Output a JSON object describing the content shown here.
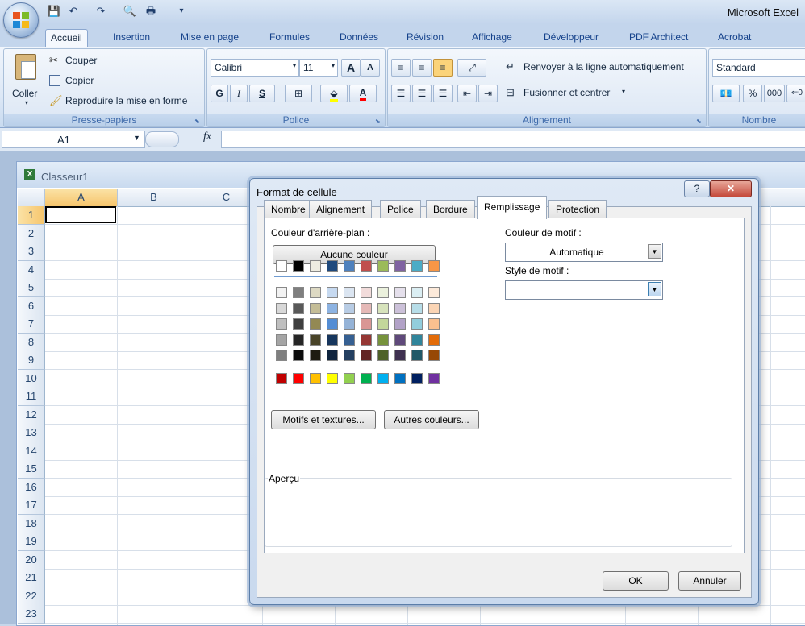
{
  "app": {
    "title": "Microsoft Excel",
    "window_title": "Classeur1"
  },
  "ribbon": {
    "tabs": [
      "Accueil",
      "Insertion",
      "Mise en page",
      "Formules",
      "Données",
      "Révision",
      "Affichage",
      "Développeur",
      "PDF Architect",
      "Acrobat"
    ],
    "active_tab": "Accueil",
    "clipboard": {
      "paste": "Coller",
      "cut": "Couper",
      "copy": "Copier",
      "format_painter": "Reproduire la mise en forme",
      "label": "Presse-papiers"
    },
    "font": {
      "name": "Calibri",
      "size": "11",
      "bold": "G",
      "italic": "I",
      "underline": "S",
      "label": "Police"
    },
    "alignment": {
      "wrap": "Renvoyer à la ligne automatiquement",
      "merge": "Fusionner et centrer",
      "label": "Alignement"
    },
    "number": {
      "format": "Standard",
      "percent": "%",
      "thousands": "000",
      "label": "Nombre"
    }
  },
  "formula_bar": {
    "name_box": "A1",
    "fx": "fx",
    "value": ""
  },
  "sheet": {
    "columns": [
      "A",
      "B",
      "C"
    ],
    "rows": [
      "1",
      "2",
      "3",
      "4",
      "5",
      "6",
      "7",
      "8",
      "9",
      "10",
      "11",
      "12",
      "13",
      "14",
      "15",
      "16",
      "17",
      "18",
      "19",
      "20",
      "21",
      "22",
      "23"
    ],
    "selected_cell": "A1"
  },
  "dialog": {
    "title": "Format de cellule",
    "help": "?",
    "close": "✕",
    "tabs": [
      "Nombre",
      "Alignement",
      "Police",
      "Bordure",
      "Remplissage",
      "Protection"
    ],
    "active_tab": "Remplissage",
    "bg_color_label": "Couleur d'arrière-plan :",
    "no_color_button": "Aucune couleur",
    "pattern_color_label": "Couleur de motif :",
    "pattern_color_value": "Automatique",
    "pattern_style_label": "Style de motif :",
    "pattern_style_value": "",
    "effects_button": "Motifs et textures...",
    "more_colors_button": "Autres couleurs...",
    "preview_label": "Aperçu",
    "ok": "OK",
    "cancel": "Annuler",
    "theme_colors": [
      "#ffffff",
      "#000000",
      "#eeece1",
      "#1f497d",
      "#4f81bd",
      "#c0504d",
      "#9bbb59",
      "#8064a2",
      "#4bacc6",
      "#f79646"
    ],
    "tint_rows": [
      [
        "#f2f2f2",
        "#7f7f7f",
        "#ddd9c3",
        "#c6d9f0",
        "#dbe5f1",
        "#f2dcdb",
        "#ebf1dd",
        "#e5e0ec",
        "#dbeef3",
        "#fdeada"
      ],
      [
        "#d8d8d8",
        "#595959",
        "#c4bd97",
        "#8db3e2",
        "#b8cce4",
        "#e5b9b7",
        "#d7e3bc",
        "#ccc1d9",
        "#b7dde8",
        "#fbd5b5"
      ],
      [
        "#bfbfbf",
        "#3f3f3f",
        "#938953",
        "#548dd4",
        "#95b3d7",
        "#d99694",
        "#c3d69b",
        "#b2a2c7",
        "#92cddc",
        "#fac08f"
      ],
      [
        "#a5a5a5",
        "#262626",
        "#494429",
        "#17365d",
        "#366092",
        "#953734",
        "#76923c",
        "#5f497a",
        "#31859b",
        "#e36c09"
      ],
      [
        "#7f7f7f",
        "#0c0c0c",
        "#1d1b10",
        "#0f243e",
        "#244061",
        "#632423",
        "#4f6128",
        "#3f3151",
        "#205867",
        "#974806"
      ]
    ],
    "standard_colors": [
      "#c00000",
      "#ff0000",
      "#ffc000",
      "#ffff00",
      "#92d050",
      "#00b050",
      "#00b0f0",
      "#0070c0",
      "#002060",
      "#7030a0"
    ]
  }
}
